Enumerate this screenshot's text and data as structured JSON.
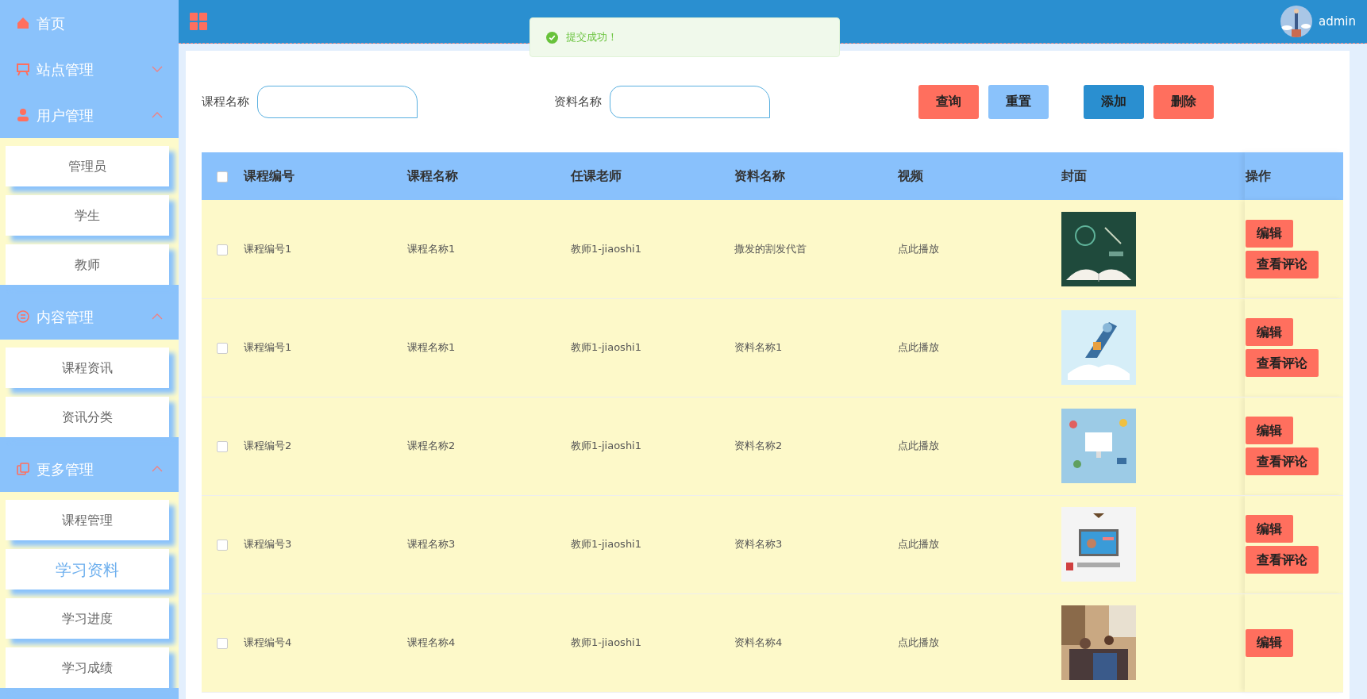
{
  "sidebar": {
    "items": [
      {
        "kind": "link",
        "label": "首页"
      },
      {
        "kind": "group",
        "label": "站点管理",
        "expanded": false
      },
      {
        "kind": "group",
        "label": "用户管理",
        "expanded": true,
        "children": [
          {
            "label": "管理员",
            "selected": false
          },
          {
            "label": "学生",
            "selected": false
          },
          {
            "label": "教师",
            "selected": false
          }
        ]
      },
      {
        "kind": "group",
        "label": "内容管理",
        "expanded": true,
        "children": [
          {
            "label": "课程资讯",
            "selected": false
          },
          {
            "label": "资讯分类",
            "selected": false
          }
        ]
      },
      {
        "kind": "group",
        "label": "更多管理",
        "expanded": true,
        "children": [
          {
            "label": "课程管理",
            "selected": false
          },
          {
            "label": "学习资料",
            "selected": true
          },
          {
            "label": "学习进度",
            "selected": false
          },
          {
            "label": "学习成绩",
            "selected": false
          }
        ]
      }
    ]
  },
  "header": {
    "user": "admin"
  },
  "toast": {
    "message": "提交成功！"
  },
  "search": {
    "fields": [
      {
        "label": "课程名称"
      },
      {
        "label": "资料名称"
      }
    ],
    "buttons": [
      {
        "label": "查询",
        "color": "#ff6f5e"
      },
      {
        "label": "重置",
        "color": "#8ac2fb"
      },
      {
        "label": "添加",
        "color": "#2a8fd0"
      },
      {
        "label": "删除",
        "color": "#ff6f5e"
      }
    ]
  },
  "table": {
    "select_all": false,
    "columns": [
      "课程编号",
      "课程名称",
      "任课老师",
      "资料名称",
      "视频",
      "封面"
    ],
    "action_column": "操作",
    "rows": [
      {
        "selected": false,
        "cells": [
          "课程编号1",
          "课程名称1",
          "教师1-jiaoshi1",
          "撒发的割发代首",
          "点此播放"
        ],
        "actions": [
          "编辑",
          "查看评论"
        ]
      },
      {
        "selected": false,
        "cells": [
          "课程编号1",
          "课程名称1",
          "教师1-jiaoshi1",
          "资料名称1",
          "点此播放"
        ],
        "actions": [
          "编辑",
          "查看评论"
        ]
      },
      {
        "selected": false,
        "cells": [
          "课程编号2",
          "课程名称2",
          "教师1-jiaoshi1",
          "资料名称2",
          "点此播放"
        ],
        "actions": [
          "编辑",
          "查看评论"
        ]
      },
      {
        "selected": false,
        "cells": [
          "课程编号3",
          "课程名称3",
          "教师1-jiaoshi1",
          "资料名称3",
          "点此播放"
        ],
        "actions": [
          "编辑",
          "查看评论"
        ]
      },
      {
        "selected": false,
        "cells": [
          "课程编号4",
          "课程名称4",
          "教师1-jiaoshi1",
          "资料名称4",
          "点此播放"
        ],
        "actions": [
          "编辑"
        ]
      }
    ]
  }
}
